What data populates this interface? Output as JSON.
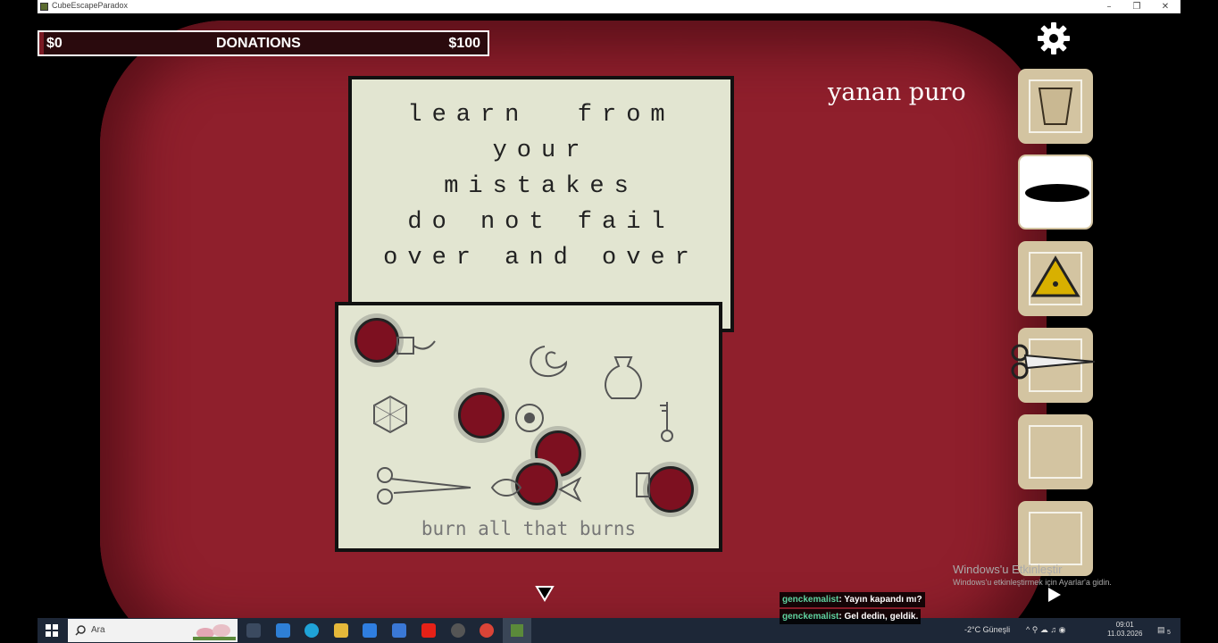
{
  "window": {
    "title": "CubeEscapeParadox"
  },
  "donations": {
    "min": "$0",
    "title": "DONATIONS",
    "max": "$100",
    "progress_fraction": 0
  },
  "note": {
    "lines": [
      "learn  from",
      "your",
      "mistakes",
      "do not fail",
      "over and over"
    ]
  },
  "puzzle": {
    "caption": "burn all that burns"
  },
  "selected_item_name": "yanan puro",
  "inventory": {
    "slots": [
      {
        "item": "glass-icon",
        "selected": false
      },
      {
        "item": "cigar-icon",
        "selected": true
      },
      {
        "item": "triangle-eye-icon",
        "selected": false
      },
      {
        "item": "scissors-icon",
        "selected": false
      },
      {
        "item": "",
        "selected": false
      },
      {
        "item": "",
        "selected": false
      }
    ]
  },
  "watermark": {
    "line1": "Windows'u Etkinleştir",
    "line2": "Windows'u etkinleştirmek için Ayarlar'a gidin."
  },
  "chat": [
    {
      "user": "genckemalist",
      "text": ": Yayın kapandı mı?"
    },
    {
      "user": "genckemalist",
      "text": ": Gel dedin, geldik."
    }
  ],
  "taskbar": {
    "search_placeholder": "Ara",
    "weather": "-2°C  Güneşli",
    "time": "09:01",
    "date": "11.03.2026",
    "notif_count": "5"
  },
  "colors": {
    "background_red": "#8f1f2c",
    "paper": "#e2e5d1",
    "slot": "#d3c4a1"
  }
}
